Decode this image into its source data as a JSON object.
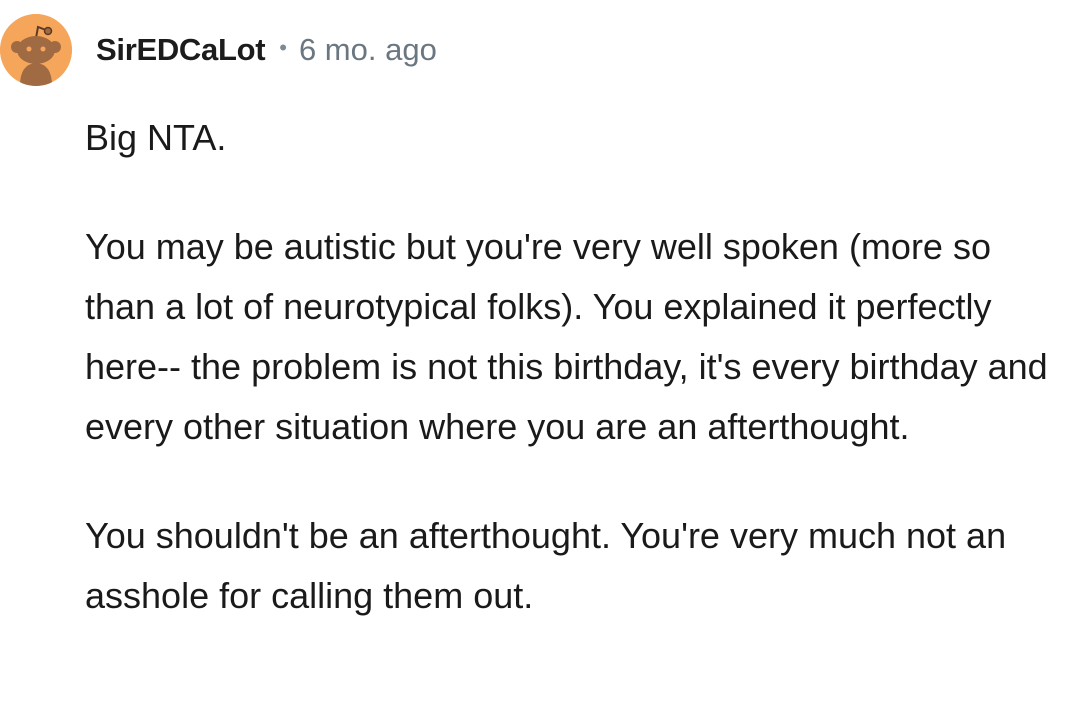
{
  "comment": {
    "author": "SirEDCaLot",
    "separator": "•",
    "timestamp": "6 mo. ago",
    "avatar_icon": "snoo-avatar-icon",
    "avatar_color": "#f6a65b",
    "paragraphs": [
      "Big NTA.",
      "You may be autistic but you're very well spoken (more so than a lot of neurotypical folks). You explained it perfectly here-- the problem is not this birthday, it's every birthday and every other situation where you are an afterthought.",
      "You shouldn't be an afterthought. You're very much not an asshole for calling them out."
    ]
  }
}
